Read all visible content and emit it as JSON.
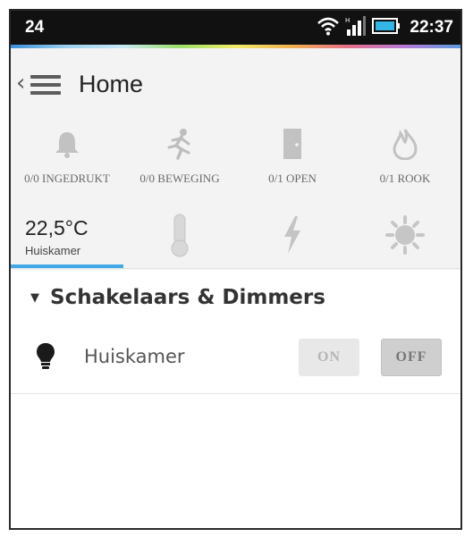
{
  "statusbar": {
    "notification": "24",
    "time": "22:37"
  },
  "actionbar": {
    "back_glyph": "‹",
    "title": "Home"
  },
  "sensors": [
    {
      "label": "0/0 INGEDRUKT",
      "icon": "bell-icon"
    },
    {
      "label": "0/0 BEWEGING",
      "icon": "running-person-icon"
    },
    {
      "label": "0/1 OPEN",
      "icon": "door-icon"
    },
    {
      "label": "0/1 ROOK",
      "icon": "flame-icon"
    }
  ],
  "tiles": {
    "temperature": {
      "value": "22,5°C",
      "room": "Huiskamer"
    },
    "icons": [
      "thermometer-icon",
      "lightning-icon",
      "sun-icon"
    ]
  },
  "section": {
    "caret": "▼",
    "title": "Schakelaars & Dimmers"
  },
  "switch": {
    "name": "Huiskamer",
    "icon": "lightbulb-icon",
    "on_label": "ON",
    "off_label": "OFF",
    "state": "off"
  },
  "colors": {
    "accent": "#43a8e6",
    "statusbar": "#111111",
    "panel": "#f3f3f3"
  }
}
